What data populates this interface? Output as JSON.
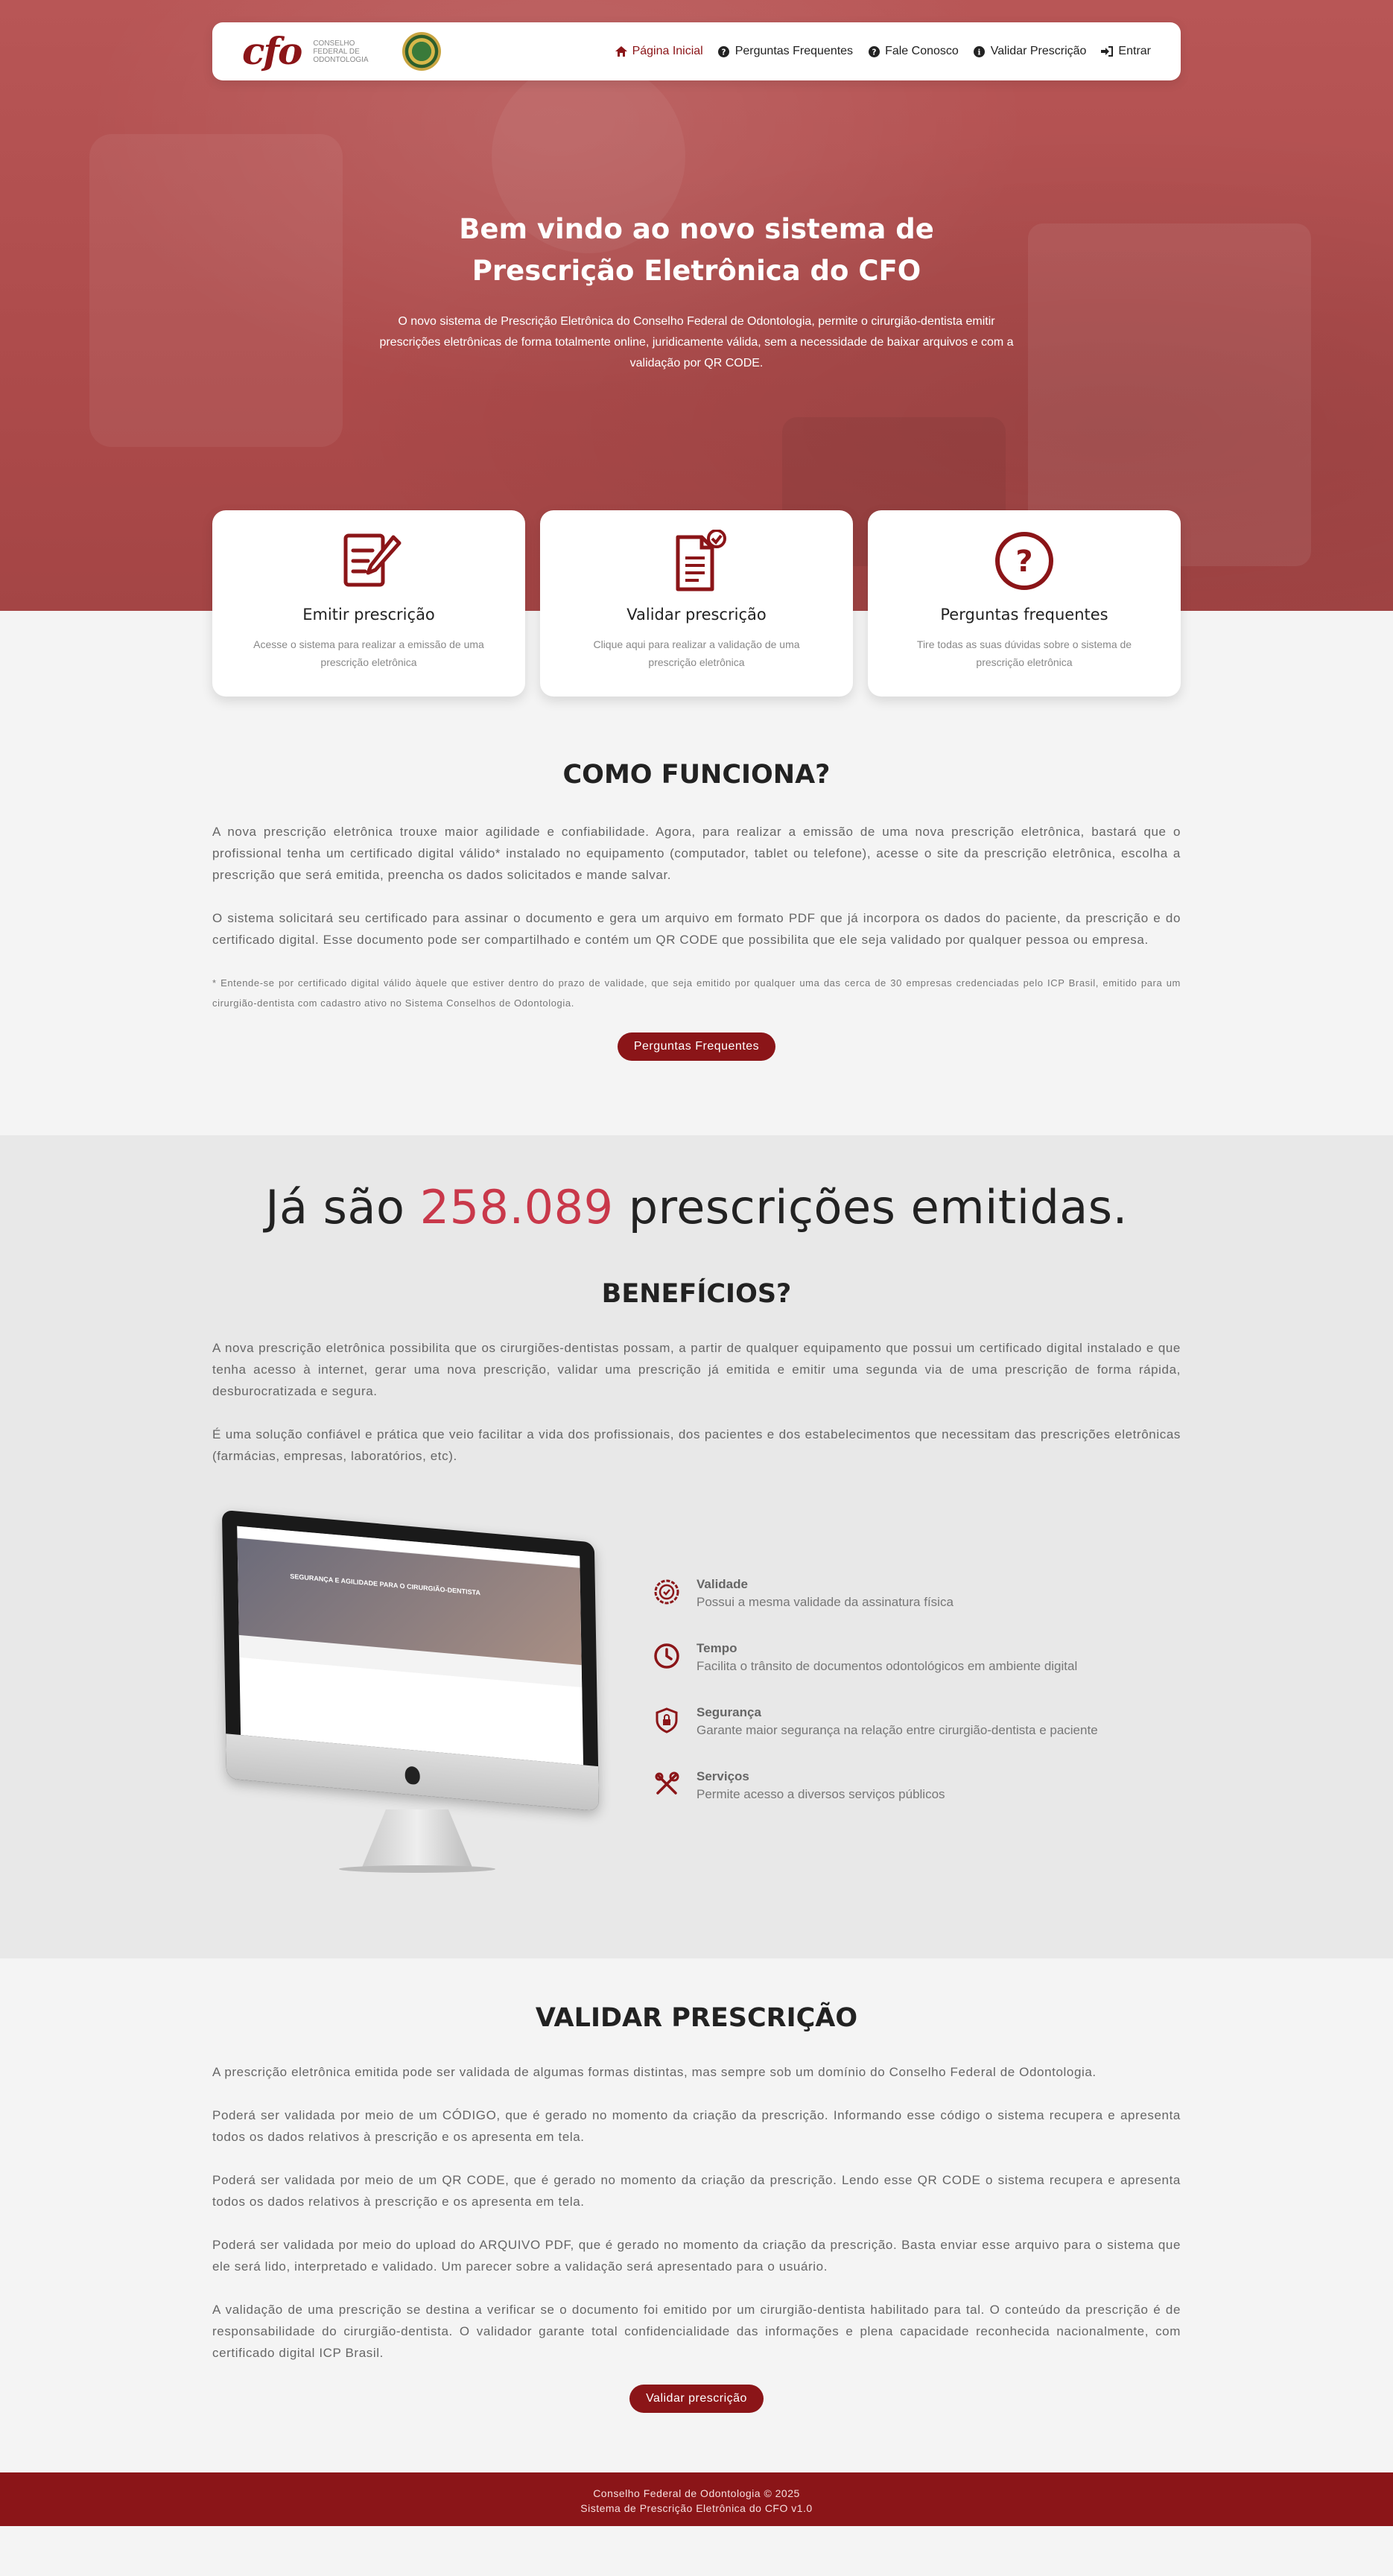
{
  "header": {
    "logo_text": "cfo",
    "logo_subtitle": "CONSELHO FEDERAL DE ODONTOLOGIA",
    "nav": [
      {
        "label": "Página Inicial",
        "icon": "home-icon"
      },
      {
        "label": "Perguntas Frequentes",
        "icon": "question-icon"
      },
      {
        "label": "Fale Conosco",
        "icon": "question-icon"
      },
      {
        "label": "Validar Prescrição",
        "icon": "info-icon"
      },
      {
        "label": "Entrar",
        "icon": "sign-in-icon"
      }
    ]
  },
  "hero": {
    "title_line1": "Bem vindo ao novo sistema de",
    "title_line2": "Prescrição Eletrônica do CFO",
    "subtitle": "O novo sistema de Prescrição Eletrônica do Conselho Federal de Odontologia, permite o cirurgião-dentista emitir prescrições eletrônicas de forma totalmente online, juridicamente válida, sem a necessidade de baixar arquivos e com a validação por QR CODE."
  },
  "cards": [
    {
      "title": "Emitir prescrição",
      "text": "Acesse o sistema para realizar a emissão de uma prescrição eletrônica",
      "icon": "edit-document-icon"
    },
    {
      "title": "Validar prescrição",
      "text": "Clique aqui para realizar a validação de uma prescrição eletrônica",
      "icon": "validate-document-icon"
    },
    {
      "title": "Perguntas frequentes",
      "text": "Tire todas as suas dúvidas sobre o sistema de prescrição eletrônica",
      "icon": "question-circle-icon"
    }
  ],
  "como_funciona": {
    "title": "COMO FUNCIONA?",
    "p1": "A nova prescrição eletrônica trouxe maior agilidade e confiabilidade. Agora, para realizar a emissão de uma nova prescrição eletrônica, bastará que o profissional tenha um certificado digital válido* instalado no equipamento (computador, tablet ou telefone), acesse o site da prescrição eletrônica, escolha a prescrição que será emitida, preencha os dados solicitados e mande salvar.",
    "p2": "O sistema solicitará seu certificado para assinar o documento e gera um arquivo em formato PDF que já incorpora os dados do paciente, da prescrição e do certificado digital. Esse documento pode ser compartilhado e contém um QR CODE que possibilita que ele seja validado por qualquer pessoa ou empresa.",
    "note": "* Entende-se por certificado digital válido àquele que estiver dentro do prazo de validade, que seja emitido por qualquer uma das cerca de 30 empresas credenciadas pelo ICP Brasil, emitido para um cirurgião-dentista com cadastro ativo no Sistema Conselhos de Odontologia.",
    "button": "Perguntas Frequentes"
  },
  "counter": {
    "prefix": "Já são",
    "number": "258.089",
    "suffix": "prescrições emitidas."
  },
  "beneficios": {
    "title": "BENEFÍCIOS?",
    "p1": "A nova prescrição eletrônica possibilita que os cirurgiões-dentistas possam, a partir de qualquer equipamento que possui um certificado digital instalado e que tenha acesso à internet, gerar uma nova prescrição, validar uma prescrição já emitida e emitir uma segunda via de uma prescrição de forma rápida, desburocratizada e segura.",
    "p2": "É uma solução confiável e prática que veio facilitar a vida dos profissionais, dos pacientes e dos estabelecimentos que necessitam das prescrições eletrônicas (farmácias, empresas, laboratórios, etc).",
    "screen_text": "SEGURANÇA E AGILIDADE PARA O CIRURGIÃO-DENTISTA",
    "features": [
      {
        "title": "Validade",
        "text": "Possui a mesma validade da assinatura física",
        "icon": "badge-check-icon"
      },
      {
        "title": "Tempo",
        "text": "Facilita o trânsito de documentos odontológicos em ambiente digital",
        "icon": "clock-icon"
      },
      {
        "title": "Segurança",
        "text": "Garante maior segurança na relação entre cirurgião-dentista e paciente",
        "icon": "shield-lock-icon"
      },
      {
        "title": "Serviços",
        "text": "Permite acesso a diversos serviços públicos",
        "icon": "tools-icon"
      }
    ]
  },
  "validar": {
    "title": "VALIDAR PRESCRIÇÃO",
    "paragraphs": [
      "A prescrição eletrônica emitida pode ser validada de algumas formas distintas, mas sempre sob um domínio do Conselho Federal de Odontologia.",
      "Poderá ser validada por meio de um CÓDIGO, que é gerado no momento da criação da prescrição. Informando esse código o sistema recupera e apresenta todos os dados relativos à prescrição e os apresenta em tela.",
      "Poderá ser validada por meio de um QR CODE, que é gerado no momento da criação da prescrição. Lendo esse QR CODE o sistema recupera e apresenta todos os dados relativos à prescrição e os apresenta em tela.",
      "Poderá ser validada por meio do upload do ARQUIVO PDF, que é gerado no momento da criação da prescrição. Basta enviar esse arquivo para o sistema que ele será lido, interpretado e validado. Um parecer sobre a validação será apresentado para o usuário.",
      "A validação de uma prescrição se destina a verificar se o documento foi emitido por um cirurgião-dentista habilitado para tal. O conteúdo da prescrição é de responsabilidade do cirurgião-dentista. O validador garante total confidencialidade das informações e plena capacidade reconhecida nacionalmente, com certificado digital ICP Brasil."
    ],
    "button": "Validar prescrição"
  },
  "footer": {
    "line1": "Conselho Federal de Odontologia © 2025",
    "line2": "Sistema de Prescrição Eletrônica do CFO v1.0"
  },
  "colors": {
    "brand": "#8b1518",
    "hero": "#ad4b4b",
    "counter_number": "#c9384a"
  }
}
